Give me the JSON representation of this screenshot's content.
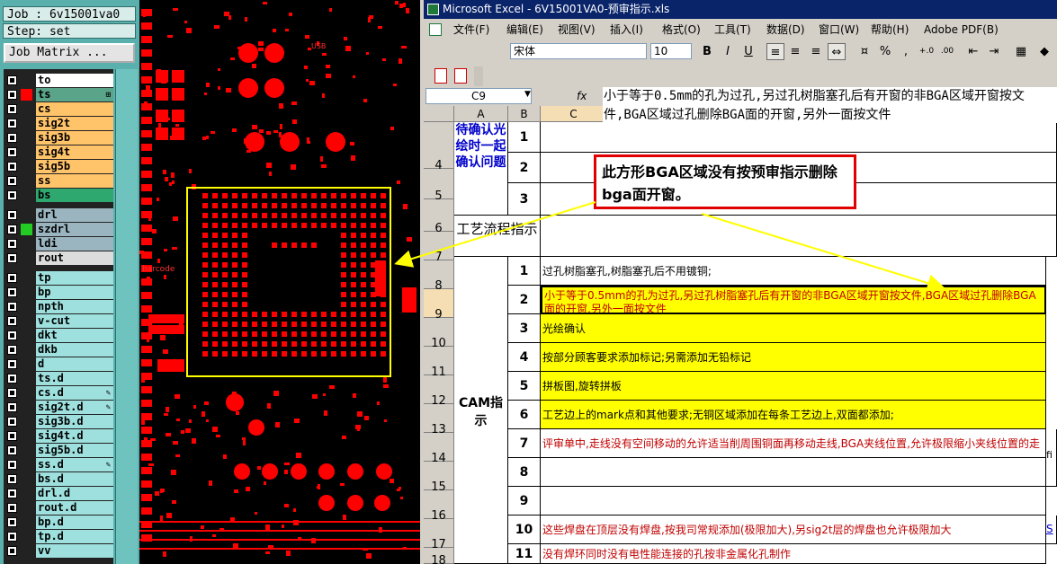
{
  "cam": {
    "job": "Job : 6v15001va0",
    "step": "Step: set",
    "job_matrix_button": "Job Matrix ...",
    "layers": [
      {
        "name": "to",
        "color": "#ffffff",
        "swatch": "",
        "mark": ""
      },
      {
        "name": "ts",
        "color": "#5aa58a",
        "swatch": "#ff0000",
        "mark": "⊞"
      },
      {
        "name": "cs",
        "color": "#ffc36a",
        "swatch": "",
        "mark": ""
      },
      {
        "name": "sig2t",
        "color": "#ffc36a",
        "swatch": "",
        "mark": ""
      },
      {
        "name": "sig3b",
        "color": "#ffc36a",
        "swatch": "",
        "mark": ""
      },
      {
        "name": "sig4t",
        "color": "#ffc36a",
        "swatch": "",
        "mark": ""
      },
      {
        "name": "sig5b",
        "color": "#ffc36a",
        "swatch": "",
        "mark": ""
      },
      {
        "name": "ss",
        "color": "#ffc36a",
        "swatch": "",
        "mark": ""
      },
      {
        "name": "bs",
        "color": "#2fa86f",
        "swatch": "",
        "mark": ""
      },
      {
        "name": "drl",
        "color": "#9bb5c0",
        "swatch": "",
        "mark": ""
      },
      {
        "name": "szdrl",
        "color": "#9bb5c0",
        "swatch": "#22cc22",
        "mark": ""
      },
      {
        "name": "ldi",
        "color": "#9bb5c0",
        "swatch": "",
        "mark": ""
      },
      {
        "name": "rout",
        "color": "#dcdcdc",
        "swatch": "",
        "mark": ""
      },
      {
        "name": "tp",
        "color": "#9ee0de",
        "swatch": "",
        "mark": ""
      },
      {
        "name": "bp",
        "color": "#9ee0de",
        "swatch": "",
        "mark": ""
      },
      {
        "name": "npth",
        "color": "#9ee0de",
        "swatch": "",
        "mark": ""
      },
      {
        "name": "v-cut",
        "color": "#9ee0de",
        "swatch": "",
        "mark": ""
      },
      {
        "name": "dkt",
        "color": "#9ee0de",
        "swatch": "",
        "mark": ""
      },
      {
        "name": "dkb",
        "color": "#9ee0de",
        "swatch": "",
        "mark": ""
      },
      {
        "name": "d",
        "color": "#9ee0de",
        "swatch": "",
        "mark": ""
      },
      {
        "name": "ts.d",
        "color": "#9ee0de",
        "swatch": "",
        "mark": ""
      },
      {
        "name": "cs.d",
        "color": "#9ee0de",
        "swatch": "",
        "mark": "✎"
      },
      {
        "name": "sig2t.d",
        "color": "#9ee0de",
        "swatch": "",
        "mark": "✎"
      },
      {
        "name": "sig3b.d",
        "color": "#9ee0de",
        "swatch": "",
        "mark": ""
      },
      {
        "name": "sig4t.d",
        "color": "#9ee0de",
        "swatch": "",
        "mark": ""
      },
      {
        "name": "sig5b.d",
        "color": "#9ee0de",
        "swatch": "",
        "mark": ""
      },
      {
        "name": "ss.d",
        "color": "#9ee0de",
        "swatch": "",
        "mark": "✎"
      },
      {
        "name": "bs.d",
        "color": "#9ee0de",
        "swatch": "",
        "mark": ""
      },
      {
        "name": "drl.d",
        "color": "#9ee0de",
        "swatch": "",
        "mark": ""
      },
      {
        "name": "rout.d",
        "color": "#9ee0de",
        "swatch": "",
        "mark": ""
      },
      {
        "name": "bp.d",
        "color": "#9ee0de",
        "swatch": "",
        "mark": ""
      },
      {
        "name": "tp.d",
        "color": "#9ee0de",
        "swatch": "",
        "mark": ""
      },
      {
        "name": "vv",
        "color": "#9ee0de",
        "swatch": "",
        "mark": ""
      }
    ]
  },
  "pcb": {
    "silk_label_barcode": "barcode",
    "silk_label_usb": "USB",
    "pad_color": "#ff0000",
    "highlight_color": "#ffff00"
  },
  "excel": {
    "title": "Microsoft Excel - 6V15001VA0-预审指示.xls",
    "menu": [
      "文件(F)",
      "编辑(E)",
      "视图(V)",
      "插入(I)",
      "格式(O)",
      "工具(T)",
      "数据(D)",
      "窗口(W)",
      "帮助(H)",
      "Adobe PDF(B)"
    ],
    "font_name": "宋体",
    "font_size": "10",
    "format_buttons": [
      "B",
      "I",
      "U"
    ],
    "name_box": "C9",
    "fx": "fx",
    "formula": "小于等于0.5mm的孔为过孔,另过孔树脂塞孔后有开窗的非BGA区域开窗按文件,BGA区域过孔删除BGA面的开窗,另外一面按文件",
    "columns": [
      "A",
      "B",
      "C"
    ],
    "row_headers": [
      "4",
      "5",
      "6",
      "7",
      "8",
      "9",
      "10",
      "11",
      "12",
      "13",
      "14",
      "15",
      "16",
      "17",
      "18"
    ],
    "section_confirm": "待确认光绘时一起确认问题",
    "section_process": "工艺流程指示",
    "section_cam": "CAM指示",
    "confirm_rows": [
      "1",
      "2",
      "3"
    ],
    "cam_rows": [
      {
        "num": "1",
        "text": "过孔树脂塞孔,树脂塞孔后不用镀铜;",
        "style": "plain"
      },
      {
        "num": "2",
        "text": "小于等于0.5mm的孔为过孔,另过孔树脂塞孔后有开窗的非BGA区域开窗按文件,BGA区域过孔删除BGA面的开窗,另外一面按文件",
        "style": "yellow-red"
      },
      {
        "num": "3",
        "text": "光绘确认",
        "style": "yellow"
      },
      {
        "num": "4",
        "text": "按部分顾客要求添加标记;另需添加无铅标记",
        "style": "yellow"
      },
      {
        "num": "5",
        "text": "拼板图,旋转拼板",
        "style": "yellow"
      },
      {
        "num": "6",
        "text": "工艺边上的mark点和其他要求;无铜区域添加在每条工艺边上,双面都添加;",
        "style": "yellow"
      },
      {
        "num": "7",
        "text": "评审单中,走线没有空间移动的允许适当削周围铜面再移动走线,BGA夹线位置,允许极限缩小夹线位置的走线",
        "style": "red"
      },
      {
        "num": "8",
        "text": "",
        "style": "plain"
      },
      {
        "num": "9",
        "text": "",
        "style": "plain"
      },
      {
        "num": "10",
        "text": "这些焊盘在顶层没有焊盘,按我司常规添加(极限加大),另sig2t层的焊盘也允许极限加大",
        "style": "red"
      },
      {
        "num": "11",
        "text": "没有焊环同时没有电性能连接的孔按非金属化孔制作",
        "style": "red"
      }
    ],
    "right_edge_texts": [
      "fi",
      "S"
    ],
    "callout": "此方形BGA区域没有按预审指示删除bga面开窗。"
  }
}
